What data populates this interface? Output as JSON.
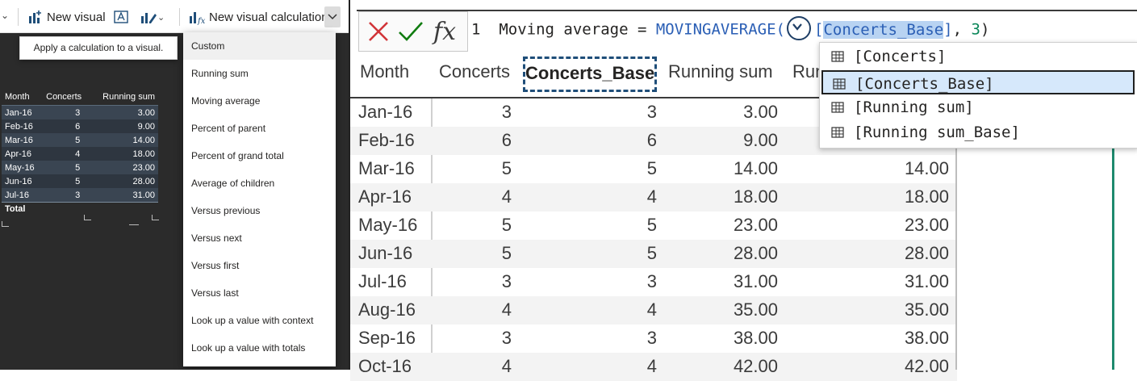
{
  "ribbon": {
    "new_visual_label": "New visual",
    "new_visual_calc_label": "New visual calculation"
  },
  "tooltip": "Apply a calculation to a visual.",
  "menu": {
    "items": [
      "Custom",
      "Running sum",
      "Moving average",
      "Percent of parent",
      "Percent of grand total",
      "Average of children",
      "Versus previous",
      "Versus next",
      "Versus first",
      "Versus last",
      "Look up a value with context",
      "Look up a value with totals"
    ]
  },
  "mini_table": {
    "headers": [
      "Month",
      "Concerts",
      "Running sum"
    ],
    "rows": [
      [
        "Jan-16",
        "3",
        "3.00"
      ],
      [
        "Feb-16",
        "6",
        "9.00"
      ],
      [
        "Mar-16",
        "5",
        "14.00"
      ],
      [
        "Apr-16",
        "4",
        "18.00"
      ],
      [
        "May-16",
        "5",
        "23.00"
      ],
      [
        "Jun-16",
        "5",
        "28.00"
      ],
      [
        "Jul-16",
        "3",
        "31.00"
      ]
    ],
    "total_label": "Total"
  },
  "formula": {
    "line_number": "1",
    "prefix": "Moving average = ",
    "function": "MOVINGAVERAGE(",
    "bracket_open": "[",
    "selected_ref": "Concerts_Base",
    "bracket_close": "]",
    "rest": ", ",
    "arg": "3",
    "close": ")"
  },
  "grid": {
    "headers": [
      "Month",
      "Concerts",
      "Concerts_Base",
      "Running sum",
      "Run"
    ],
    "rows": [
      [
        "Jan-16",
        "3",
        "3",
        "3.00",
        ""
      ],
      [
        "Feb-16",
        "6",
        "6",
        "9.00",
        ""
      ],
      [
        "Mar-16",
        "5",
        "5",
        "14.00",
        "14.00"
      ],
      [
        "Apr-16",
        "4",
        "4",
        "18.00",
        "18.00"
      ],
      [
        "May-16",
        "5",
        "5",
        "23.00",
        "23.00"
      ],
      [
        "Jun-16",
        "5",
        "5",
        "28.00",
        "28.00"
      ],
      [
        "Jul-16",
        "3",
        "3",
        "31.00",
        "31.00"
      ],
      [
        "Aug-16",
        "4",
        "4",
        "35.00",
        "35.00"
      ],
      [
        "Sep-16",
        "3",
        "3",
        "38.00",
        "38.00"
      ],
      [
        "Oct-16",
        "4",
        "4",
        "42.00",
        "42.00"
      ]
    ]
  },
  "autocomplete": {
    "items": [
      "[Concerts]",
      "[Concerts_Base]",
      "[Running sum]",
      "[Running sum_Base]"
    ],
    "selected_index": 1
  },
  "colors": {
    "accent_green": "#1e8a6e",
    "selection_blue": "#d6e8fb",
    "function_blue": "#2b5fb5"
  }
}
